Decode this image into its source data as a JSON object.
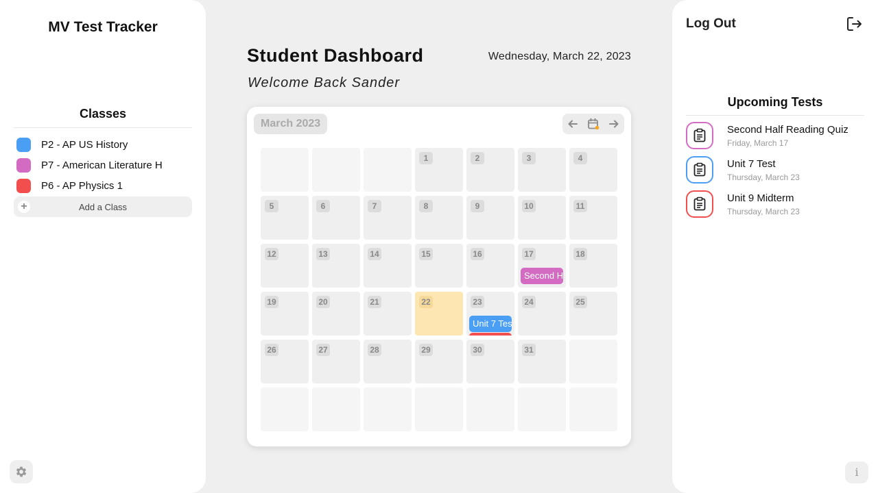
{
  "app": {
    "title": "MV Test Tracker"
  },
  "sidebar": {
    "classes_heading": "Classes",
    "classes": [
      {
        "label": "P2 - AP US History",
        "color": "#4a9ff5"
      },
      {
        "label": "P7 - American Literature H",
        "color": "#d36bc3"
      },
      {
        "label": "P6 - AP Physics 1",
        "color": "#f24e4e"
      }
    ],
    "add_class_icon": "+",
    "add_class_label": "Add a Class",
    "settings_icon": "gear-icon"
  },
  "header": {
    "title": "Student Dashboard",
    "date": "Wednesday, March 22, 2023",
    "welcome": "Welcome Back Sander"
  },
  "calendar": {
    "month_label": "March 2023",
    "nav": {
      "prev_icon": "arrow-left-icon",
      "today_icon": "calendar-today-icon",
      "next_icon": "arrow-right-icon"
    },
    "weeks": [
      [
        null,
        null,
        null,
        "1",
        "2",
        "3",
        "4"
      ],
      [
        "5",
        "6",
        "7",
        "8",
        "9",
        "10",
        "11"
      ],
      [
        "12",
        "13",
        "14",
        "15",
        "16",
        "17",
        "18"
      ],
      [
        "19",
        "20",
        "21",
        "22",
        "23",
        "24",
        "25"
      ],
      [
        "26",
        "27",
        "28",
        "29",
        "30",
        "31",
        null
      ],
      [
        null,
        null,
        null,
        null,
        null,
        null,
        null
      ]
    ],
    "today": "22",
    "events": [
      {
        "day": "17",
        "label": "Second Half Reading Quiz",
        "color": "#d36bc3"
      },
      {
        "day": "23",
        "label": "Unit 7 Test",
        "color": "#4a9ff5"
      },
      {
        "day": "23",
        "label": "Unit 9 Midterm",
        "color": "#f24e4e"
      }
    ]
  },
  "right_panel": {
    "logout_label": "Log Out",
    "logout_icon": "logout-icon",
    "upcoming_heading": "Upcoming Tests",
    "tests": [
      {
        "name": "Second Half Reading Quiz",
        "date": "Friday, March 17",
        "color": "#d36bc3"
      },
      {
        "name": "Unit 7 Test",
        "date": "Thursday, March 23",
        "color": "#4a9ff5"
      },
      {
        "name": "Unit 9 Midterm",
        "date": "Thursday, March 23",
        "color": "#f24e4e"
      }
    ],
    "info_label": "i"
  }
}
